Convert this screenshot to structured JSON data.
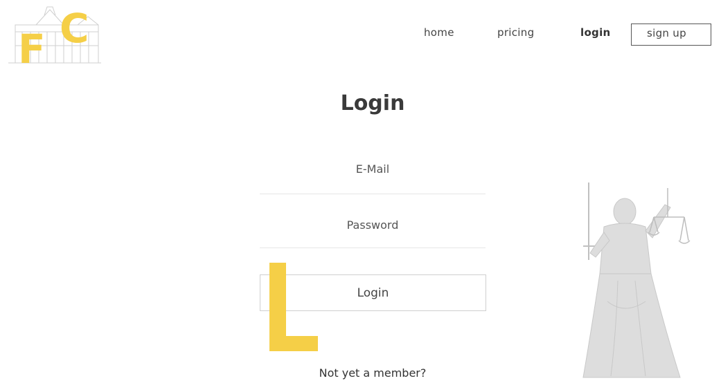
{
  "colors": {
    "accent": "#f5cf47",
    "sketch": "#cfcfcf"
  },
  "logo": {
    "letter_f": "F",
    "letter_c": "C"
  },
  "nav": {
    "home": "home",
    "pricing": "pricing",
    "login": "login",
    "signup": "sign up"
  },
  "form": {
    "title": "Login",
    "email_placeholder": "E-Mail",
    "password_placeholder": "Password",
    "submit_label": "Login",
    "member_link": "Not yet a member?"
  },
  "decor": {
    "big_letter": "L",
    "illustration": "justice-statue"
  }
}
